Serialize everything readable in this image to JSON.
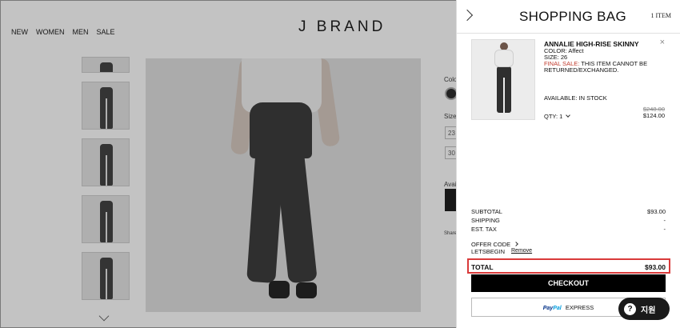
{
  "nav": {
    "items": [
      "NEW",
      "WOMEN",
      "MEN",
      "SALE"
    ]
  },
  "brand": {
    "logo": "J BRAND"
  },
  "product_side": {
    "color_label": "Color",
    "size_label": "Size:",
    "sizes": [
      "23",
      "30"
    ],
    "avail_label": "Avail",
    "share_label": "Share"
  },
  "bag": {
    "title": "SHOPPING BAG",
    "item_count": "1 ITEM",
    "item": {
      "name": "ANNALIE HIGH-RISE SKINNY",
      "color": "COLOR: Affect",
      "size": "SIZE: 26",
      "final_sale_label": "FINAL SALE:",
      "final_sale_note_line1": "THIS ITEM CANNOT BE",
      "final_sale_note_line2": "RETURNED/EXCHANGED.",
      "availability": "AVAILABLE: IN STOCK",
      "qty": "QTY: 1",
      "price_original": "$248.00",
      "price_current": "$124.00"
    },
    "summary": {
      "subtotal_label": "SUBTOTAL",
      "subtotal_value": "$93.00",
      "shipping_label": "SHIPPING",
      "shipping_value": "-",
      "tax_label": "EST. TAX",
      "tax_value": "-",
      "offer_label": "OFFER CODE",
      "offer_code": "LETSBEGIN",
      "offer_remove": "Remove",
      "total_label": "TOTAL",
      "total_value": "$93.00"
    },
    "checkout_label": "CHECKOUT",
    "paypal": {
      "brand_a": "Pay",
      "brand_b": "Pal",
      "label": "EXPRESS"
    }
  },
  "help": {
    "icon": "?",
    "label": "지원"
  },
  "colors": {
    "highlight_border": "#d93a3a",
    "final_sale": "#c0392b"
  }
}
